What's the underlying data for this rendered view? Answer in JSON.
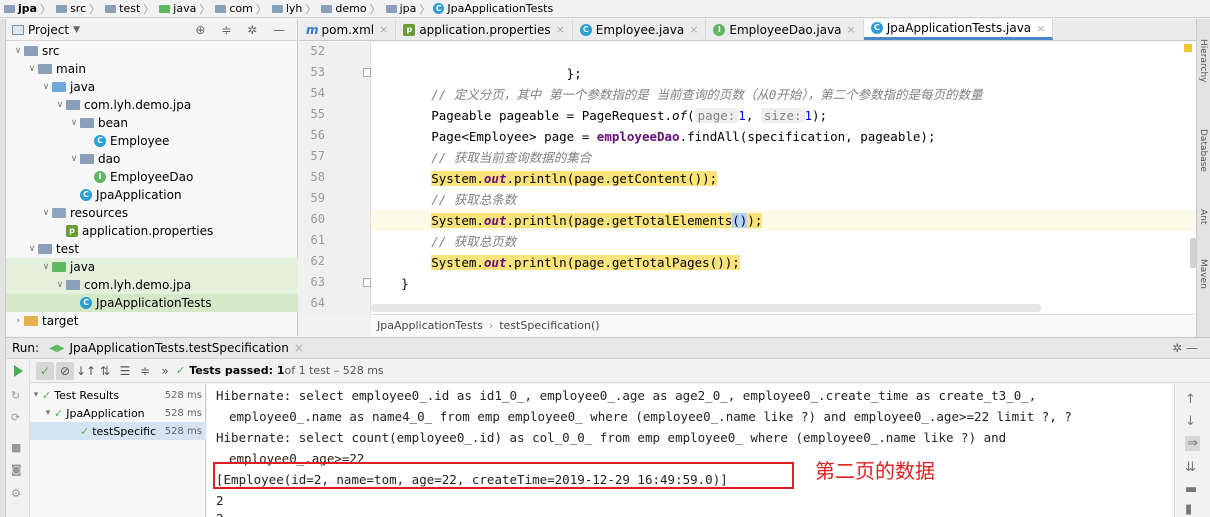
{
  "breadcrumb": [
    "jpa",
    "src",
    "test",
    "java",
    "com",
    "lyh",
    "demo",
    "jpa",
    "JpaApplicationTests"
  ],
  "project_panel": {
    "title": "Project",
    "tree": [
      {
        "label": "src",
        "indent": 1,
        "arrow": "down",
        "icon": "folder"
      },
      {
        "label": "main",
        "indent": 2,
        "arrow": "down",
        "icon": "folder"
      },
      {
        "label": "java",
        "indent": 3,
        "arrow": "down",
        "icon": "folder-blue"
      },
      {
        "label": "com.lyh.demo.jpa",
        "indent": 4,
        "arrow": "down",
        "icon": "package"
      },
      {
        "label": "bean",
        "indent": 5,
        "arrow": "down",
        "icon": "package"
      },
      {
        "label": "Employee",
        "indent": 6,
        "arrow": "",
        "icon": "class"
      },
      {
        "label": "dao",
        "indent": 5,
        "arrow": "down",
        "icon": "package"
      },
      {
        "label": "EmployeeDao",
        "indent": 6,
        "arrow": "",
        "icon": "interface"
      },
      {
        "label": "JpaApplication",
        "indent": 5,
        "arrow": "",
        "icon": "class"
      },
      {
        "label": "resources",
        "indent": 3,
        "arrow": "down",
        "icon": "folder-res"
      },
      {
        "label": "application.properties",
        "indent": 4,
        "arrow": "",
        "icon": "properties"
      },
      {
        "label": "test",
        "indent": 2,
        "arrow": "down",
        "icon": "folder"
      },
      {
        "label": "java",
        "indent": 3,
        "arrow": "down",
        "icon": "folder-green"
      },
      {
        "label": "com.lyh.demo.jpa",
        "indent": 4,
        "arrow": "down",
        "icon": "package"
      },
      {
        "label": "JpaApplicationTests",
        "indent": 5,
        "arrow": "",
        "icon": "class"
      },
      {
        "label": "target",
        "indent": 1,
        "arrow": "right",
        "icon": "folder-orange"
      }
    ]
  },
  "tabs": [
    {
      "label": "pom.xml",
      "icon": "m"
    },
    {
      "label": "application.properties",
      "icon": "p"
    },
    {
      "label": "Employee.java",
      "icon": "c"
    },
    {
      "label": "EmployeeDao.java",
      "icon": "i"
    },
    {
      "label": "JpaApplicationTests.java",
      "icon": "c"
    }
  ],
  "editor": {
    "line_numbers": [
      "52",
      "53",
      "54",
      "55",
      "56",
      "57",
      "58",
      "59",
      "60",
      "61",
      "62",
      "63",
      "64"
    ],
    "lines": {
      "l53": "};",
      "l54": "// 定义分页，其中 第一个参数指的是 当前查询的页数（从0开始），第二个参数指的是每页的数量",
      "l55a": "Pageable pageable = PageRequest.",
      "l55b": "of",
      "l55c": "(",
      "l55hint1": "page:",
      "l55n1": "1",
      "l55d": ", ",
      "l55hint2": "size:",
      "l55n2": "1",
      "l55e": ");",
      "l56a": "Page<Employee> page = ",
      "l56b": "employeeDao",
      "l56c": ".findAll(specification, pageable);",
      "l57": "// 获取当前查询数据的集合",
      "l58a": "System.",
      "l58b": "out",
      "l58c": ".println(page.getContent());",
      "l59": "// 获取总条数",
      "l60a": "System.",
      "l60b": "out",
      "l60c": ".println(page.getTotalElements",
      "l60d": "()",
      "l60e": ");",
      "l61": "// 获取总页数",
      "l62a": "System.",
      "l62b": "out",
      "l62c": ".println(page.getTotalPages());",
      "l63": "}"
    },
    "breadcrumb": [
      "JpaApplicationTests",
      "testSpecification()"
    ]
  },
  "run_panel": {
    "label": "Run:",
    "tab": "JpaApplicationTests.testSpecification",
    "status_strong": "Tests passed: 1",
    "status_rest": " of 1 test – 528 ms",
    "tests": [
      {
        "label": "Test Results",
        "time": "528 ms"
      },
      {
        "label": "JpaApplication",
        "time": "528 ms"
      },
      {
        "label": "testSpecific",
        "time": "528 ms"
      }
    ],
    "console": [
      "Hibernate: select employee0_.id as id1_0_, employee0_.age as age2_0_, employee0_.create_time as create_t3_0_,",
      "employee0_.name as name4_0_ from emp employee0_ where (employee0_.name like ?) and employee0_.age>=22 limit ?, ?",
      "Hibernate: select count(employee0_.id) as col_0_0_ from emp employee0_ where (employee0_.name like ?) and",
      "employee0_.age>=22",
      "[Employee(id=2, name=tom, age=22, createTime=2019-12-29 16:49:59.0)]",
      "2",
      "2"
    ],
    "annotation": "第二页的数据"
  },
  "right_tools": [
    "Hierarchy",
    "Database",
    "Ant",
    "Maven"
  ],
  "colors": {
    "highlight": "#f9e47b",
    "annotation_red": "#e02020",
    "pass_green": "#4caf50"
  }
}
